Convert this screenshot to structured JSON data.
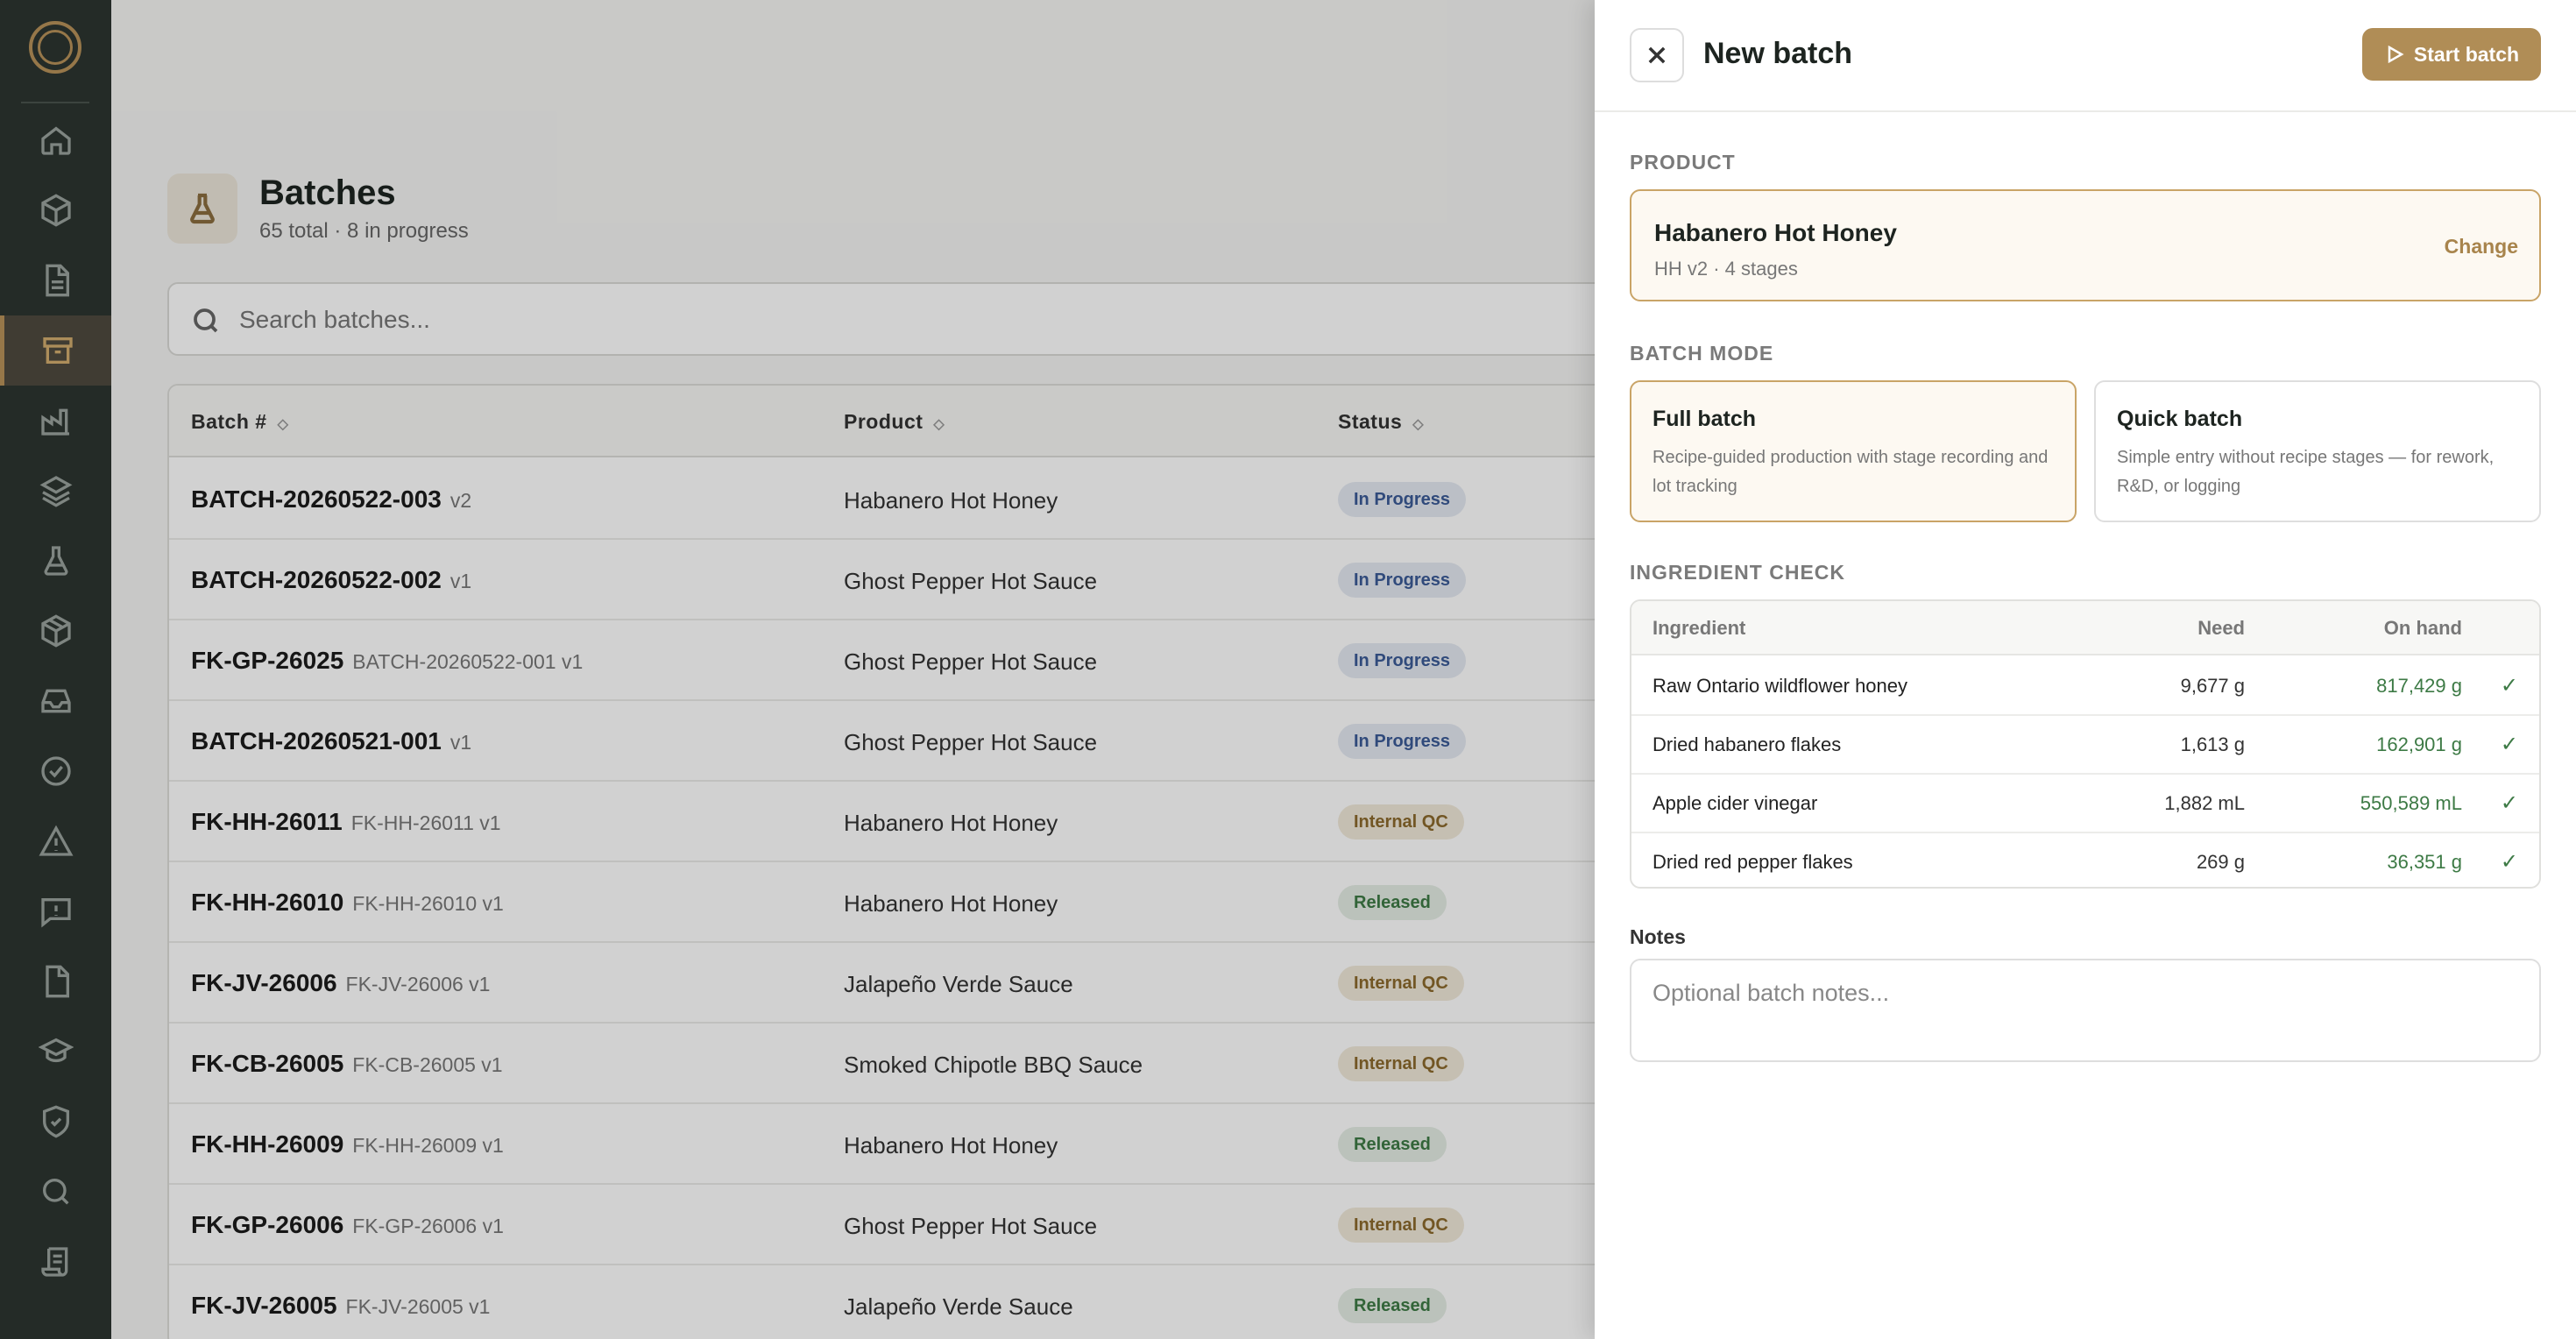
{
  "sidebar": {
    "items": [
      {
        "name": "home-icon"
      },
      {
        "name": "box-icon"
      },
      {
        "name": "document-icon"
      },
      {
        "name": "archive-icon",
        "active": true
      },
      {
        "name": "factory-icon"
      },
      {
        "name": "layers-icon"
      },
      {
        "name": "flask-icon"
      },
      {
        "name": "package-icon"
      },
      {
        "name": "inbox-icon"
      },
      {
        "name": "check-circle-icon"
      },
      {
        "name": "alert-triangle-icon"
      },
      {
        "name": "message-alert-icon"
      },
      {
        "name": "file-icon"
      },
      {
        "name": "graduation-cap-icon"
      },
      {
        "name": "shield-icon"
      },
      {
        "name": "search-icon"
      },
      {
        "name": "scroll-icon"
      }
    ]
  },
  "page": {
    "title": "Batches",
    "subtitle": "65 total · 8 in progress"
  },
  "search": {
    "placeholder": "Search batches..."
  },
  "table": {
    "columns": [
      "Batch #",
      "Product",
      "Status"
    ],
    "rows": [
      {
        "batch": "BATCH-20260522-003",
        "sub": "v2",
        "product": "Habanero Hot Honey",
        "status": "In Progress",
        "kind": "progress"
      },
      {
        "batch": "BATCH-20260522-002",
        "sub": "v1",
        "product": "Ghost Pepper Hot Sauce",
        "status": "In Progress",
        "kind": "progress"
      },
      {
        "batch": "FK-GP-26025",
        "sub": "BATCH-20260522-001  v1",
        "product": "Ghost Pepper Hot Sauce",
        "status": "In Progress",
        "kind": "progress"
      },
      {
        "batch": "BATCH-20260521-001",
        "sub": "v1",
        "product": "Ghost Pepper Hot Sauce",
        "status": "In Progress",
        "kind": "progress"
      },
      {
        "batch": "FK-HH-26011",
        "sub": "FK-HH-26011  v1",
        "product": "Habanero Hot Honey",
        "status": "Internal QC",
        "kind": "qc"
      },
      {
        "batch": "FK-HH-26010",
        "sub": "FK-HH-26010  v1",
        "product": "Habanero Hot Honey",
        "status": "Released",
        "kind": "released"
      },
      {
        "batch": "FK-JV-26006",
        "sub": "FK-JV-26006  v1",
        "product": "Jalapeño Verde Sauce",
        "status": "Internal QC",
        "kind": "qc"
      },
      {
        "batch": "FK-CB-26005",
        "sub": "FK-CB-26005  v1",
        "product": "Smoked Chipotle BBQ Sauce",
        "status": "Internal QC",
        "kind": "qc"
      },
      {
        "batch": "FK-HH-26009",
        "sub": "FK-HH-26009  v1",
        "product": "Habanero Hot Honey",
        "status": "Released",
        "kind": "released"
      },
      {
        "batch": "FK-GP-26006",
        "sub": "FK-GP-26006  v1",
        "product": "Ghost Pepper Hot Sauce",
        "status": "Internal QC",
        "kind": "qc"
      },
      {
        "batch": "FK-JV-26005",
        "sub": "FK-JV-26005  v1",
        "product": "Jalapeño Verde Sauce",
        "status": "Released",
        "kind": "released"
      }
    ]
  },
  "drawer": {
    "title": "New batch",
    "start_label": "Start batch",
    "product_label": "PRODUCT",
    "product": {
      "name": "Habanero Hot Honey",
      "meta": "HH   v2 · 4 stages",
      "change_label": "Change"
    },
    "mode_label": "BATCH MODE",
    "modes": [
      {
        "title": "Full batch",
        "desc": "Recipe-guided production with stage recording and lot tracking",
        "selected": true
      },
      {
        "title": "Quick batch",
        "desc": "Simple entry without recipe stages — for rework, R&D, or logging",
        "selected": false
      }
    ],
    "ingredient_label": "INGREDIENT CHECK",
    "ingredient_columns": {
      "name": "Ingredient",
      "need": "Need",
      "hand": "On hand"
    },
    "ingredients": [
      {
        "name": "Raw Ontario wildflower honey",
        "need": "9,677 g",
        "hand": "817,429 g",
        "check": "✓"
      },
      {
        "name": "Dried habanero flakes",
        "need": "1,613 g",
        "hand": "162,901 g",
        "check": "✓"
      },
      {
        "name": "Apple cider vinegar",
        "need": "1,882 mL",
        "hand": "550,589 mL",
        "check": "✓"
      },
      {
        "name": "Dried red pepper flakes",
        "need": "269 g",
        "hand": "36,351 g",
        "check": "✓"
      }
    ],
    "notes_label": "Notes",
    "notes_placeholder": "Optional batch notes..."
  },
  "colors": {
    "sidebar": "#2c3530",
    "accent": "#b08d56",
    "in_progress": "#3b5b97",
    "internal_qc": "#8b6a2c",
    "released": "#3d7a45"
  }
}
